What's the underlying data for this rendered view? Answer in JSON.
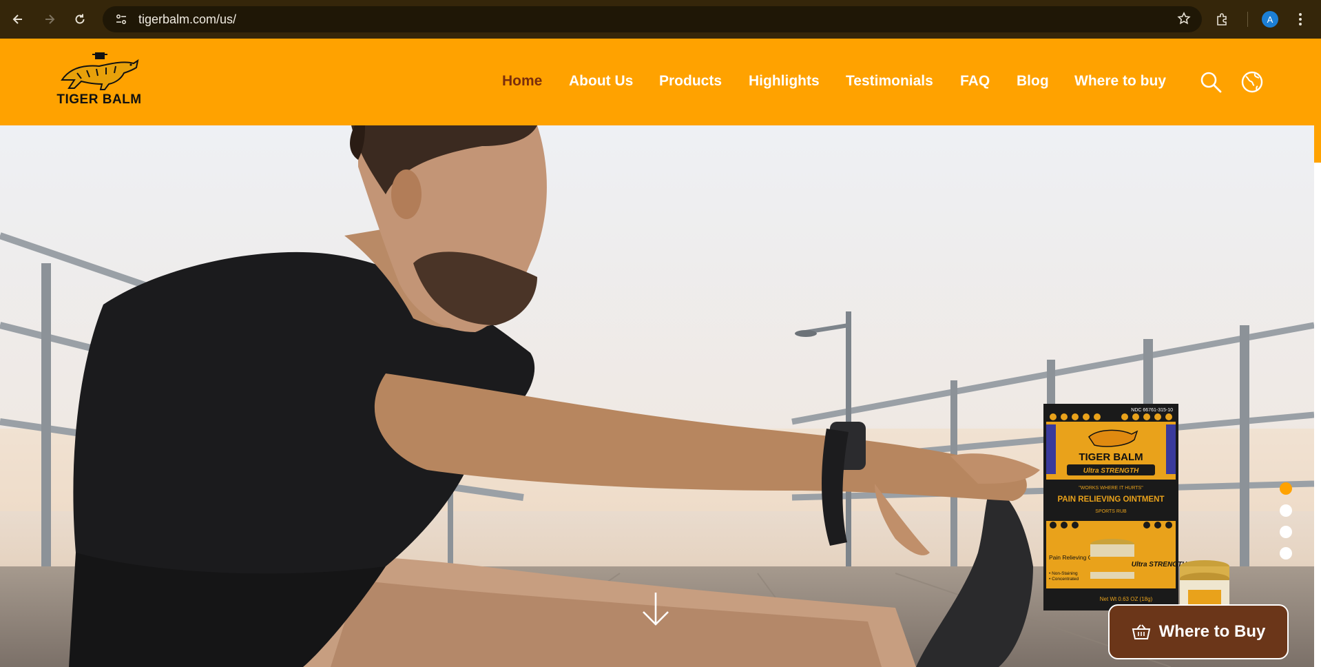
{
  "browser": {
    "url": "tigerbalm.com/us/",
    "profile_initial": "A"
  },
  "brand": {
    "name": "TIGER BALM",
    "colors": {
      "header": "#ffa200",
      "active_nav": "#7a2e0c",
      "cta": "#6b3619"
    }
  },
  "nav": {
    "items": [
      {
        "label": "Home",
        "active": true
      },
      {
        "label": "About Us",
        "active": false
      },
      {
        "label": "Products",
        "active": false
      },
      {
        "label": "Highlights",
        "active": false
      },
      {
        "label": "Testimonials",
        "active": false
      },
      {
        "label": "FAQ",
        "active": false
      },
      {
        "label": "Blog",
        "active": false
      },
      {
        "label": "Where to buy",
        "active": false
      }
    ]
  },
  "hero": {
    "product": {
      "ndc": "NDC 66761-315-10",
      "brand": "TIGER BALM",
      "variant": "Ultra STRENGTH",
      "tagline": "\"WORKS WHERE IT HURTS\"",
      "name": "PAIN RELIEVING OINTMENT",
      "sub": "SPORTS RUB",
      "side_title": "Pain Relieving Ointment",
      "bullets": [
        "• Non-Staining",
        "• Concentrated"
      ],
      "net_wt": "Net Wt 0.63 OZ (18g)",
      "side_brand": "Ultra STRENGTH"
    },
    "slides": {
      "count": 4,
      "active_index": 0
    }
  },
  "cta": {
    "label": "Where to Buy"
  },
  "icons": [
    "back-icon",
    "forward-icon",
    "reload-icon",
    "site-info-icon",
    "star-icon",
    "extensions-icon",
    "menu-icon",
    "search-icon",
    "globe-icon",
    "arrow-down-icon",
    "basket-icon"
  ]
}
